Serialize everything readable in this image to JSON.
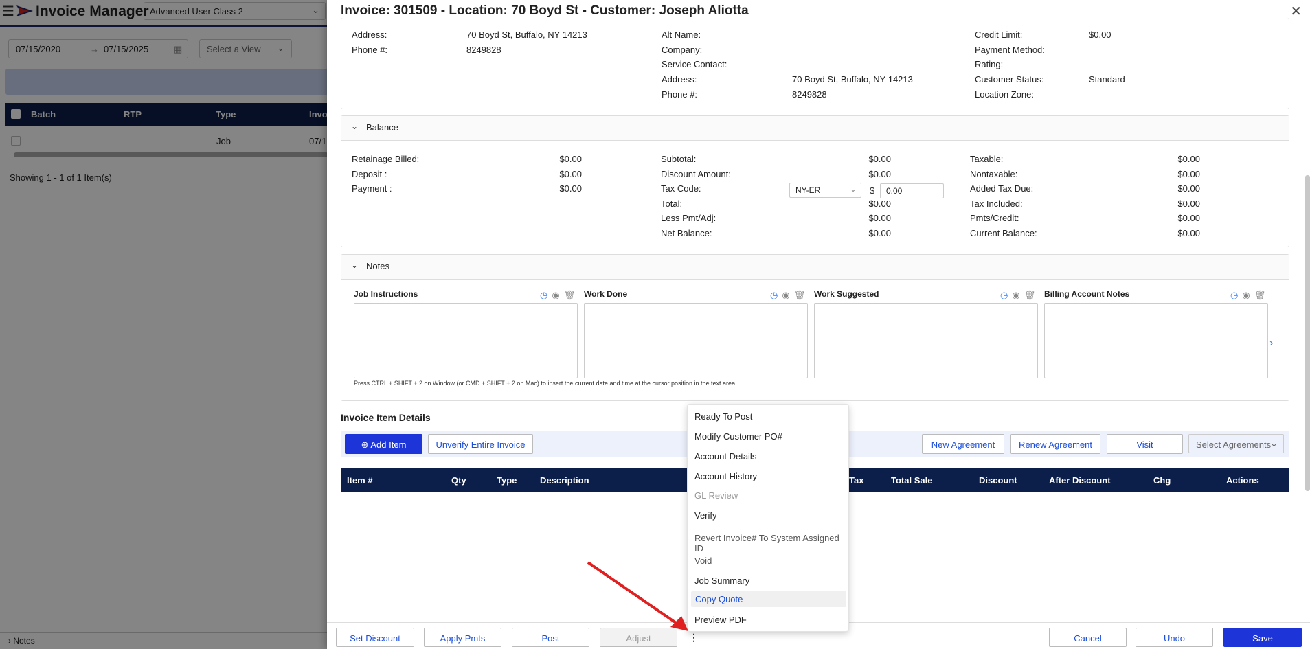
{
  "app": {
    "title": "Invoice Manager",
    "user_class": "Advanced User Class 2",
    "date_from": "07/15/2020",
    "date_to": "07/15/2025",
    "view_placeholder": "Select a View",
    "date_separator": "→"
  },
  "grid": {
    "columns": [
      "Batch",
      "RTP",
      "Type",
      "Invo"
    ],
    "row": {
      "type": "Job",
      "invoice": "07/1"
    },
    "showing": "Showing 1 - 1 of 1 Item(s)",
    "notes_toggle": "Notes"
  },
  "panel": {
    "title": "Invoice: 301509 - Location: 70 Boyd St - Customer: Joseph Aliotta",
    "location": {
      "address_label": "Address:",
      "address_value": "70 Boyd St, Buffalo, NY 14213",
      "phone_label": "Phone #:",
      "phone_value": "8249828"
    },
    "customer": {
      "alt_name_label": "Alt Name:",
      "company_label": "Company:",
      "service_contact_label": "Service Contact:",
      "address_label": "Address:",
      "address_value": "70 Boyd St, Buffalo, NY 14213",
      "phone_label": "Phone #:",
      "phone_value": "8249828"
    },
    "account": {
      "credit_limit_label": "Credit Limit:",
      "credit_limit_value": "$0.00",
      "payment_method_label": "Payment Method:",
      "rating_label": "Rating:",
      "status_label": "Customer Status:",
      "status_value": "Standard",
      "zone_label": "Location Zone:"
    },
    "balance": {
      "title": "Balance",
      "col1": [
        {
          "label": "Retainage Billed:",
          "value": "$0.00"
        },
        {
          "label": "Deposit :",
          "value": "$0.00"
        },
        {
          "label": "Payment :",
          "value": "$0.00"
        }
      ],
      "col2": [
        {
          "label": "Subtotal:",
          "value": "$0.00"
        },
        {
          "label": "Discount Amount:",
          "value": "$0.00"
        },
        {
          "label": "Tax Code:",
          "value": ""
        },
        {
          "label": "Total:",
          "value": "$0.00"
        },
        {
          "label": "Less Pmt/Adj:",
          "value": "$0.00"
        },
        {
          "label": "Net Balance:",
          "value": "$0.00"
        }
      ],
      "col3": [
        {
          "label": "Taxable:",
          "value": "$0.00"
        },
        {
          "label": "Nontaxable:",
          "value": "$0.00"
        },
        {
          "label": "Added Tax Due:",
          "value": "$0.00"
        },
        {
          "label": "Tax Included:",
          "value": "$0.00"
        },
        {
          "label": "Pmts/Credit:",
          "value": "$0.00"
        },
        {
          "label": "Current Balance:",
          "value": "$0.00"
        }
      ],
      "tax_code": "NY-ER",
      "tax_currency": "$",
      "tax_amount": "0.00"
    },
    "notes": {
      "title": "Notes",
      "boxes": [
        "Job Instructions",
        "Work Done",
        "Work Suggested",
        "Billing Account Notes"
      ],
      "hint": "Press CTRL + SHIFT + 2 on Window (or CMD + SHIFT + 2 on Mac) to insert the current date and time at the cursor position in the text area."
    },
    "items": {
      "title": "Invoice Item Details",
      "add_item": "Add Item",
      "unverify": "Unverify Entire Invoice",
      "new_agreement": "New Agreement",
      "renew_agreement": "Renew Agreement",
      "visit": "Visit",
      "agreements_placeholder": "Select Agreements",
      "columns": [
        "Item #",
        "Qty",
        "Type",
        "Description",
        "Tax",
        "Total Sale",
        "Discount",
        "After Discount",
        "Chg",
        "Actions"
      ]
    },
    "footer": {
      "set_discount": "Set Discount",
      "apply_pmts": "Apply Pmts",
      "post": "Post",
      "adjust": "Adjust",
      "cancel": "Cancel",
      "undo": "Undo",
      "save": "Save"
    },
    "menu": [
      "Ready To Post",
      "Modify Customer PO#",
      "Account Details",
      "Account History",
      "GL Review",
      "Verify",
      "Revert Invoice# To System Assigned ID",
      "Void",
      "Job Summary",
      "Copy Quote",
      "Preview PDF"
    ]
  },
  "colors": {
    "primary": "#1d35d8",
    "header_navy": "#0c1e4a",
    "link": "#1d4ed8",
    "arrow": "#e02020"
  }
}
